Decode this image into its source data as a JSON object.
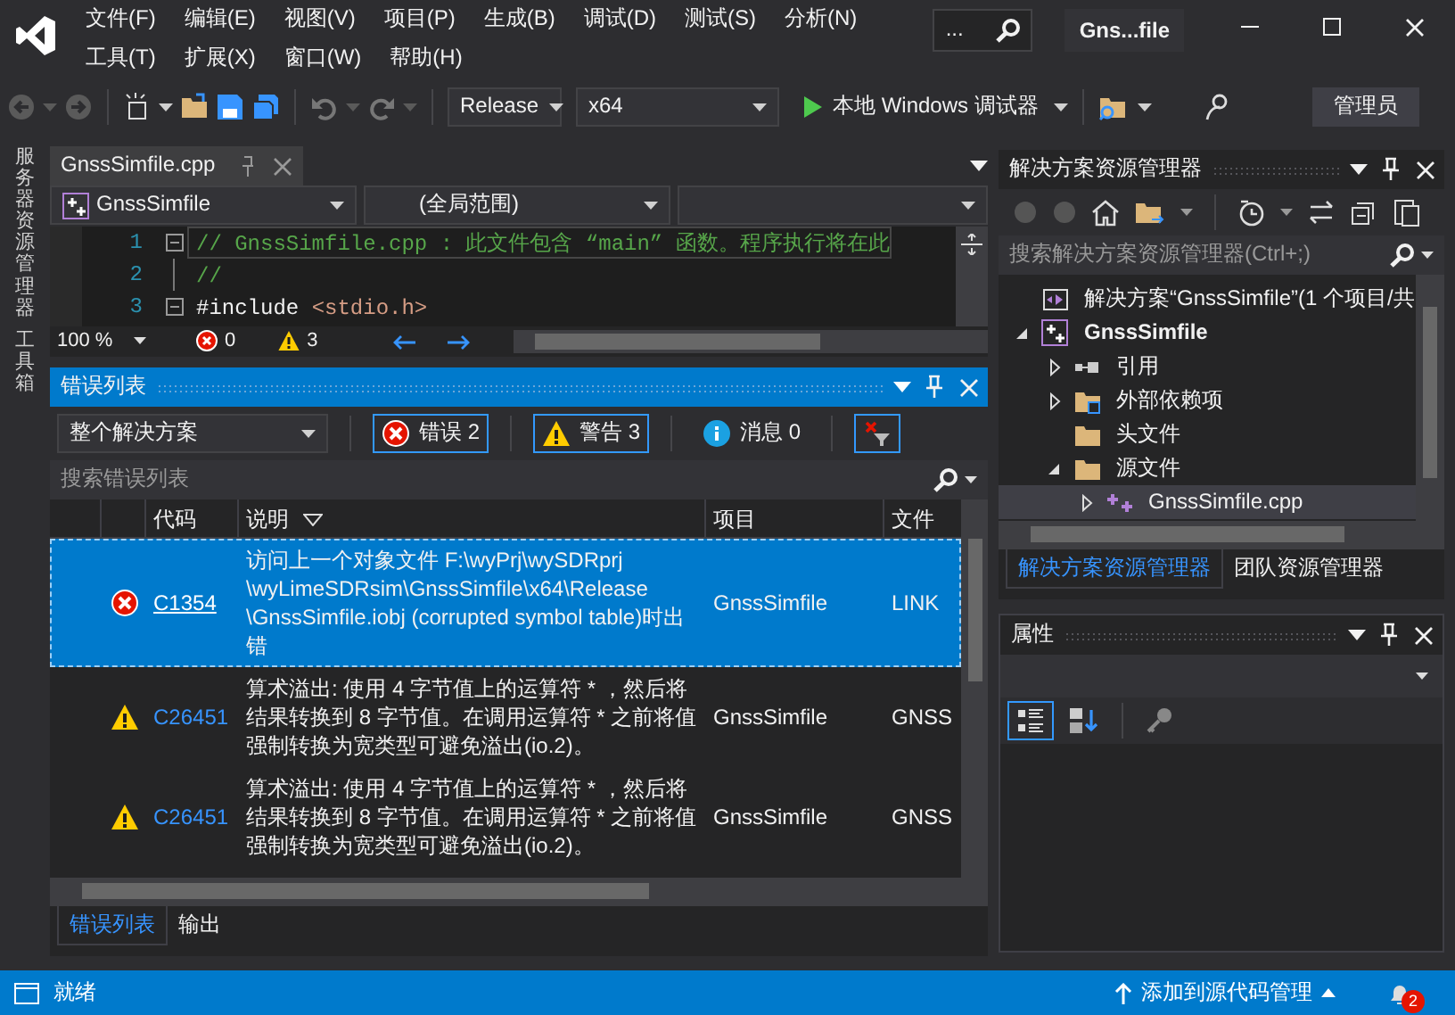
{
  "title_bar": {
    "search": "...",
    "title": "Gns...file"
  },
  "menu": [
    [
      "文件(F)",
      "编辑(E)",
      "视图(V)",
      "项目(P)",
      "生成(B)",
      "调试(D)",
      "测试(S)",
      "分析(N)"
    ],
    [
      "工具(T)",
      "扩展(X)",
      "窗口(W)",
      "帮助(H)"
    ]
  ],
  "toolbar": {
    "configuration": "Release",
    "platform": "x64",
    "debugger": "本地 Windows 调试器",
    "account": "管理员"
  },
  "side_tabs": [
    "服务器资源管理器",
    "工具箱"
  ],
  "editor": {
    "tab": "GnssSimfile.cpp",
    "nav": [
      "GnssSimfile",
      "(全局范围)"
    ],
    "lines": [
      {
        "number": "1",
        "kind": "comment",
        "text": "// GnssSimfile.cpp : 此文件包含 “main” 函数。程序执行将在此",
        "current": true
      },
      {
        "number": "2",
        "kind": "comment",
        "text": "//",
        "current": false
      },
      {
        "number": "3",
        "kind": "include",
        "directive": "#include",
        "argument": "<stdio.h>",
        "current": false
      }
    ],
    "zoom": "100 %",
    "errors": "0",
    "warnings": "3"
  },
  "error_list": {
    "title": "错误列表",
    "scope": "整个解决方案",
    "filters": [
      {
        "kind": "error",
        "label": "错误 2",
        "selected": true
      },
      {
        "kind": "warning",
        "label": "警告 3",
        "selected": true
      },
      {
        "kind": "info",
        "label": "消息 0",
        "selected": false
      }
    ],
    "search": {
      "placeholder": "搜索错误列表"
    },
    "columns": [
      "代码",
      "说明",
      "项目",
      "文件"
    ],
    "rows": [
      {
        "kind": "error",
        "code": "C1354",
        "description": "访问上一个对象文件 F:\\wyPrj\\wySDRprj \\wyLimeSDRsim\\GnssSimfile\\x64\\Release \\GnssSimfile.iobj (corrupted symbol table)时出错",
        "project": "GnssSimfile",
        "file": "LINK",
        "selected": true
      },
      {
        "kind": "warning",
        "code": "C26451",
        "description": "算术溢出: 使用 4 字节值上的运算符 * ，然后将结果转换到 8 字节值。在调用运算符 * 之前将值强制转换为宽类型可避免溢出(io.2)。",
        "project": "GnssSimfile",
        "file": "GNSS",
        "selected": false
      },
      {
        "kind": "warning",
        "code": "C26451",
        "description": "算术溢出: 使用 4 字节值上的运算符 * ，然后将结果转换到 8 字节值。在调用运算符 * 之前将值强制转换为宽类型可避免溢出(io.2)。",
        "project": "GnssSimfile",
        "file": "GNSS",
        "selected": false
      }
    ],
    "tabs": [
      {
        "label": "错误列表",
        "selected": true
      },
      {
        "label": "输出",
        "selected": false
      }
    ]
  },
  "solution_explorer": {
    "title": "解决方案资源管理器",
    "search": {
      "placeholder": "搜索解决方案资源管理器(Ctrl+;)"
    },
    "tree": [
      {
        "kind": "solution",
        "label": "解决方案“GnssSimfile”(1 个项目/共",
        "selected": false,
        "children": [
          {
            "kind": "project",
            "label": "GnssSimfile",
            "expanded": true,
            "selected": false,
            "children": [
              {
                "kind": "references",
                "label": "引用",
                "expanded": false,
                "selected": false
              },
              {
                "kind": "external",
                "label": "外部依赖项",
                "expanded": false,
                "selected": false
              },
              {
                "kind": "folder",
                "label": "头文件",
                "selected": false
              },
              {
                "kind": "folder",
                "label": "源文件",
                "expanded": true,
                "selected": false,
                "children": [
                  {
                    "kind": "cpp",
                    "label": "GnssSimfile.cpp",
                    "expanded": false,
                    "selected": true
                  }
                ]
              }
            ]
          }
        ]
      }
    ],
    "tabs": [
      {
        "label": "解决方案资源管理器",
        "selected": true
      },
      {
        "label": "团队资源管理器",
        "selected": false
      }
    ]
  },
  "properties": {
    "title": "属性"
  },
  "status_bar": {
    "text": "就绪",
    "source_control": "添加到源代码管理",
    "notifications": "2"
  }
}
